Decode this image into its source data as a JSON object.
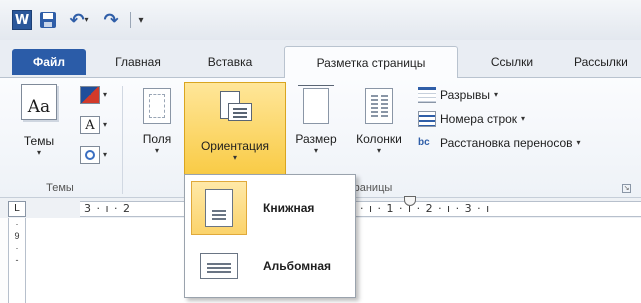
{
  "qat": {
    "app_logo": "W",
    "undo_glyph": "↶",
    "redo_glyph": "↷",
    "more_glyph": "▾"
  },
  "tabs": {
    "file": "Файл",
    "home": "Главная",
    "insert": "Вставка",
    "layout": "Разметка страницы",
    "references": "Ссылки",
    "mailings": "Рассылки"
  },
  "ribbon": {
    "themes": {
      "button": "Темы",
      "icon_text": "Aa",
      "fonts_icon_text": "A",
      "group_label": "Темы"
    },
    "page_setup": {
      "margins": "Поля",
      "orientation": "Ориентация",
      "size": "Размер",
      "columns": "Колонки",
      "breaks": "Разрывы",
      "line_numbers": "Номера строк",
      "hyphenation": "Расстановка переносов",
      "hyphenation_icon_text": "bc",
      "group_label_partial": "ры страницы"
    }
  },
  "ruler": {
    "corner": "L",
    "left_text": "3 · ı · 2",
    "right_text": "· ı · 1 · ı · 2 · ı · 3 · ı",
    "vertical_marks": [
      "·",
      "9",
      "·",
      "-"
    ]
  },
  "orientation_menu": {
    "portrait": "Книжная",
    "landscape": "Альбомная"
  },
  "colors": {
    "file_tab": "#2b5ca8",
    "active_highlight": "#f8c83c",
    "ribbon_bg": "#eef2f7"
  }
}
